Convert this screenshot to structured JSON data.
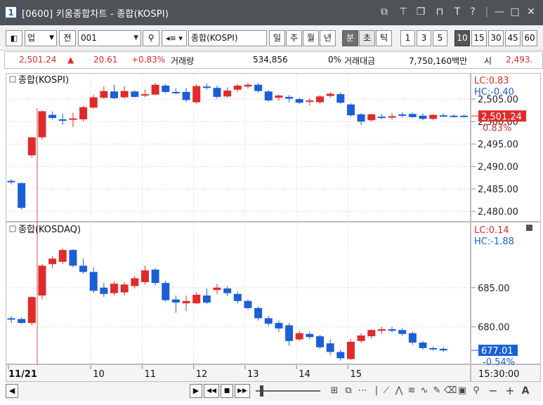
{
  "window": {
    "number": "1",
    "title": "[0600] 키움종합차트 - 종합(KOSPI)",
    "controls": [
      "⧉",
      "⊤",
      "❐",
      "⊓",
      "T",
      "?",
      "|",
      "—",
      "□",
      "✕"
    ]
  },
  "toolbar": {
    "market_select": "업",
    "prev_label": "전",
    "code_value": "001",
    "name_value": "종합(KOSPI)",
    "periods": [
      "일",
      "주",
      "월",
      "년",
      "분",
      "초",
      "틱"
    ],
    "selected_period": "분",
    "intervals": [
      "1",
      "3",
      "5",
      "10",
      "15",
      "30",
      "45",
      "60"
    ],
    "selected_interval": "10"
  },
  "quote": {
    "price": "2,501.24",
    "change_arrow": "▲",
    "change": "20.61",
    "change_pct": "+0.83%",
    "volume_label": "거래량",
    "volume": "534,856",
    "volume_ratio": "0%",
    "amount_label": "거래대금",
    "amount": "7,750,160백만",
    "open_label": "시",
    "open": "2,493."
  },
  "colors": {
    "up": "#e02b2b",
    "down": "#1a5fd6",
    "grid": "#c9c9c9",
    "cursor_line": "#d05050"
  },
  "chart_data": [
    {
      "type": "candlestick",
      "title": "종합(KOSPI)",
      "lc_label": "LC:0.83",
      "hc_label": "HC:-0.40",
      "current_label": "2,501.24",
      "current_pct_label": "0.83%",
      "current_value": 2501.24,
      "ylim": [
        2478.0,
        2510.5
      ],
      "y_ticks": [
        2505,
        2500,
        2495,
        2490,
        2485,
        2480
      ],
      "y_tick_labels": [
        "2,505.00",
        "2,500.00",
        "2,495.00",
        "2,490.00",
        "2,485.00",
        "2,480.00"
      ],
      "candles": [
        {
          "o": 2486.8,
          "h": 2487.2,
          "l": 2486.0,
          "c": 2486.5
        },
        {
          "o": 2486.3,
          "h": 2486.5,
          "l": 2480.4,
          "c": 2480.8
        },
        {
          "o": 2492.5,
          "h": 2496.5,
          "l": 2492.0,
          "c": 2496.5
        },
        {
          "o": 2496.5,
          "h": 2502.5,
          "l": 2496.0,
          "c": 2502.3
        },
        {
          "o": 2501.5,
          "h": 2502.3,
          "l": 2500.5,
          "c": 2500.8
        },
        {
          "o": 2500.5,
          "h": 2501.7,
          "l": 2499.3,
          "c": 2500.2
        },
        {
          "o": 2500.5,
          "h": 2502.0,
          "l": 2498.8,
          "c": 2500.7
        },
        {
          "o": 2500.5,
          "h": 2503.5,
          "l": 2500.0,
          "c": 2503.2
        },
        {
          "o": 2503.1,
          "h": 2505.9,
          "l": 2502.9,
          "c": 2505.4
        },
        {
          "o": 2505.3,
          "h": 2507.8,
          "l": 2505.0,
          "c": 2506.8
        },
        {
          "o": 2506.7,
          "h": 2508.2,
          "l": 2505.0,
          "c": 2505.2
        },
        {
          "o": 2505.4,
          "h": 2507.9,
          "l": 2505.1,
          "c": 2506.8
        },
        {
          "o": 2506.7,
          "h": 2507.0,
          "l": 2505.3,
          "c": 2505.5
        },
        {
          "o": 2505.8,
          "h": 2507.1,
          "l": 2505.4,
          "c": 2506.1
        },
        {
          "o": 2506.0,
          "h": 2508.6,
          "l": 2505.9,
          "c": 2508.2
        },
        {
          "o": 2508.0,
          "h": 2508.4,
          "l": 2506.3,
          "c": 2506.6
        },
        {
          "o": 2506.6,
          "h": 2507.4,
          "l": 2506.1,
          "c": 2506.5
        },
        {
          "o": 2506.6,
          "h": 2507.5,
          "l": 2504.3,
          "c": 2504.8
        },
        {
          "o": 2504.3,
          "h": 2508.3,
          "l": 2504.0,
          "c": 2507.9
        },
        {
          "o": 2507.8,
          "h": 2508.5,
          "l": 2507.1,
          "c": 2507.6
        },
        {
          "o": 2507.5,
          "h": 2508.0,
          "l": 2505.1,
          "c": 2505.5
        },
        {
          "o": 2505.6,
          "h": 2507.6,
          "l": 2505.3,
          "c": 2506.9
        },
        {
          "o": 2507.1,
          "h": 2508.4,
          "l": 2506.6,
          "c": 2508.0
        },
        {
          "o": 2507.8,
          "h": 2508.6,
          "l": 2507.3,
          "c": 2508.2
        },
        {
          "o": 2508.2,
          "h": 2508.6,
          "l": 2506.5,
          "c": 2506.8
        },
        {
          "o": 2506.7,
          "h": 2507.0,
          "l": 2504.4,
          "c": 2504.7
        },
        {
          "o": 2505.3,
          "h": 2506.0,
          "l": 2504.6,
          "c": 2505.8
        },
        {
          "o": 2505.5,
          "h": 2505.9,
          "l": 2504.3,
          "c": 2505.1
        },
        {
          "o": 2505.0,
          "h": 2505.3,
          "l": 2503.9,
          "c": 2504.2
        },
        {
          "o": 2504.4,
          "h": 2505.2,
          "l": 2503.6,
          "c": 2504.7
        },
        {
          "o": 2504.3,
          "h": 2505.9,
          "l": 2504.0,
          "c": 2505.6
        },
        {
          "o": 2505.7,
          "h": 2506.6,
          "l": 2505.3,
          "c": 2506.2
        },
        {
          "o": 2506.1,
          "h": 2506.5,
          "l": 2503.9,
          "c": 2504.2
        },
        {
          "o": 2503.8,
          "h": 2504.1,
          "l": 2501.1,
          "c": 2501.4
        },
        {
          "o": 2501.6,
          "h": 2501.9,
          "l": 2499.2,
          "c": 2500.0
        },
        {
          "o": 2500.3,
          "h": 2501.8,
          "l": 2500.0,
          "c": 2501.6
        },
        {
          "o": 2501.1,
          "h": 2501.7,
          "l": 2500.5,
          "c": 2501.0
        },
        {
          "o": 2501.1,
          "h": 2501.9,
          "l": 2500.4,
          "c": 2501.2
        },
        {
          "o": 2501.6,
          "h": 2502.1,
          "l": 2500.9,
          "c": 2501.3
        },
        {
          "o": 2501.7,
          "h": 2502.0,
          "l": 2500.8,
          "c": 2501.0
        },
        {
          "o": 2501.3,
          "h": 2501.8,
          "l": 2500.3,
          "c": 2500.6
        },
        {
          "o": 2500.6,
          "h": 2501.6,
          "l": 2500.3,
          "c": 2501.5
        },
        {
          "o": 2501.4,
          "h": 2501.8,
          "l": 2501.0,
          "c": 2501.1
        },
        {
          "o": 2501.3,
          "h": 2501.6,
          "l": 2500.9,
          "c": 2501.2
        },
        {
          "o": 2501.3,
          "h": 2501.6,
          "l": 2501.0,
          "c": 2501.2
        }
      ]
    },
    {
      "type": "candlestick",
      "title": "종합(KOSDAQ)",
      "lc_label": "LC:0.14",
      "hc_label": "HC:-1.88",
      "current_label": "677.01",
      "current_pct_label": "-0.54%",
      "current_value": 677.01,
      "ylim": [
        675.5,
        692.5
      ],
      "y_ticks": [
        685,
        680
      ],
      "y_tick_labels": [
        "685.00",
        "680.00"
      ],
      "candles": [
        {
          "o": 681.1,
          "h": 681.4,
          "l": 680.5,
          "c": 681.0
        },
        {
          "o": 681.0,
          "h": 681.2,
          "l": 680.4,
          "c": 680.5
        },
        {
          "o": 680.5,
          "h": 683.9,
          "l": 680.2,
          "c": 683.8
        },
        {
          "o": 684.0,
          "h": 688.0,
          "l": 683.5,
          "c": 687.8
        },
        {
          "o": 688.0,
          "h": 689.0,
          "l": 687.5,
          "c": 688.7
        },
        {
          "o": 688.3,
          "h": 690.0,
          "l": 688.0,
          "c": 689.8
        },
        {
          "o": 689.8,
          "h": 689.9,
          "l": 687.6,
          "c": 687.8
        },
        {
          "o": 687.8,
          "h": 688.7,
          "l": 686.8,
          "c": 687.0
        },
        {
          "o": 687.0,
          "h": 687.6,
          "l": 684.3,
          "c": 684.6
        },
        {
          "o": 685.0,
          "h": 685.6,
          "l": 683.8,
          "c": 684.2
        },
        {
          "o": 684.3,
          "h": 685.8,
          "l": 684.0,
          "c": 685.5
        },
        {
          "o": 684.4,
          "h": 685.7,
          "l": 684.0,
          "c": 685.4
        },
        {
          "o": 685.2,
          "h": 686.5,
          "l": 684.9,
          "c": 686.2
        },
        {
          "o": 685.7,
          "h": 687.8,
          "l": 685.4,
          "c": 687.2
        },
        {
          "o": 687.3,
          "h": 687.5,
          "l": 685.3,
          "c": 685.6
        },
        {
          "o": 685.6,
          "h": 685.9,
          "l": 683.2,
          "c": 683.4
        },
        {
          "o": 683.5,
          "h": 684.0,
          "l": 681.8,
          "c": 683.1
        },
        {
          "o": 683.0,
          "h": 684.0,
          "l": 682.0,
          "c": 683.3
        },
        {
          "o": 683.0,
          "h": 684.4,
          "l": 682.9,
          "c": 684.1
        },
        {
          "o": 684.0,
          "h": 684.9,
          "l": 682.9,
          "c": 683.1
        },
        {
          "o": 684.7,
          "h": 685.5,
          "l": 684.2,
          "c": 685.0
        },
        {
          "o": 684.9,
          "h": 685.2,
          "l": 683.9,
          "c": 684.3
        },
        {
          "o": 684.2,
          "h": 684.5,
          "l": 683.0,
          "c": 683.3
        },
        {
          "o": 683.3,
          "h": 683.5,
          "l": 682.2,
          "c": 682.4
        },
        {
          "o": 682.4,
          "h": 682.6,
          "l": 680.8,
          "c": 681.1
        },
        {
          "o": 681.1,
          "h": 681.4,
          "l": 680.1,
          "c": 680.4
        },
        {
          "o": 680.5,
          "h": 680.8,
          "l": 679.4,
          "c": 679.8
        },
        {
          "o": 680.2,
          "h": 680.5,
          "l": 677.6,
          "c": 678.2
        },
        {
          "o": 678.4,
          "h": 679.5,
          "l": 678.2,
          "c": 679.2
        },
        {
          "o": 679.1,
          "h": 679.4,
          "l": 678.4,
          "c": 678.7
        },
        {
          "o": 678.8,
          "h": 679.0,
          "l": 677.2,
          "c": 677.4
        },
        {
          "o": 677.9,
          "h": 678.4,
          "l": 676.4,
          "c": 676.8
        },
        {
          "o": 676.8,
          "h": 677.1,
          "l": 675.7,
          "c": 676.0
        },
        {
          "o": 675.9,
          "h": 678.4,
          "l": 675.8,
          "c": 678.1
        },
        {
          "o": 678.2,
          "h": 679.2,
          "l": 678.0,
          "c": 678.9
        },
        {
          "o": 678.8,
          "h": 679.7,
          "l": 678.5,
          "c": 679.6
        },
        {
          "o": 679.5,
          "h": 680.0,
          "l": 679.1,
          "c": 679.7
        },
        {
          "o": 679.7,
          "h": 680.0,
          "l": 679.3,
          "c": 679.5
        },
        {
          "o": 679.6,
          "h": 679.8,
          "l": 678.9,
          "c": 679.1
        },
        {
          "o": 679.2,
          "h": 679.4,
          "l": 677.7,
          "c": 678.0
        },
        {
          "o": 678.0,
          "h": 678.2,
          "l": 677.1,
          "c": 677.3
        },
        {
          "o": 677.3,
          "h": 677.5,
          "l": 677.0,
          "c": 677.2
        },
        {
          "o": 677.2,
          "h": 677.4,
          "l": 676.8,
          "c": 677.0
        }
      ]
    }
  ],
  "x_axis": {
    "labels": [
      "11/21",
      "10",
      "11",
      "12",
      "13",
      "14",
      "15"
    ],
    "label_candle_index": [
      0,
      8,
      13,
      18,
      23,
      28,
      33
    ],
    "time_label": "15:30:00"
  },
  "bottombar": {
    "left_btn": "◀",
    "nav": [
      "▶",
      "◀◀",
      "■",
      "▶▶"
    ],
    "icons": [
      "magnifier-icon",
      "minus-icon",
      "plus-icon",
      "text-icon"
    ],
    "minus_label": "−",
    "plus_label": "+",
    "text_label": "A"
  }
}
